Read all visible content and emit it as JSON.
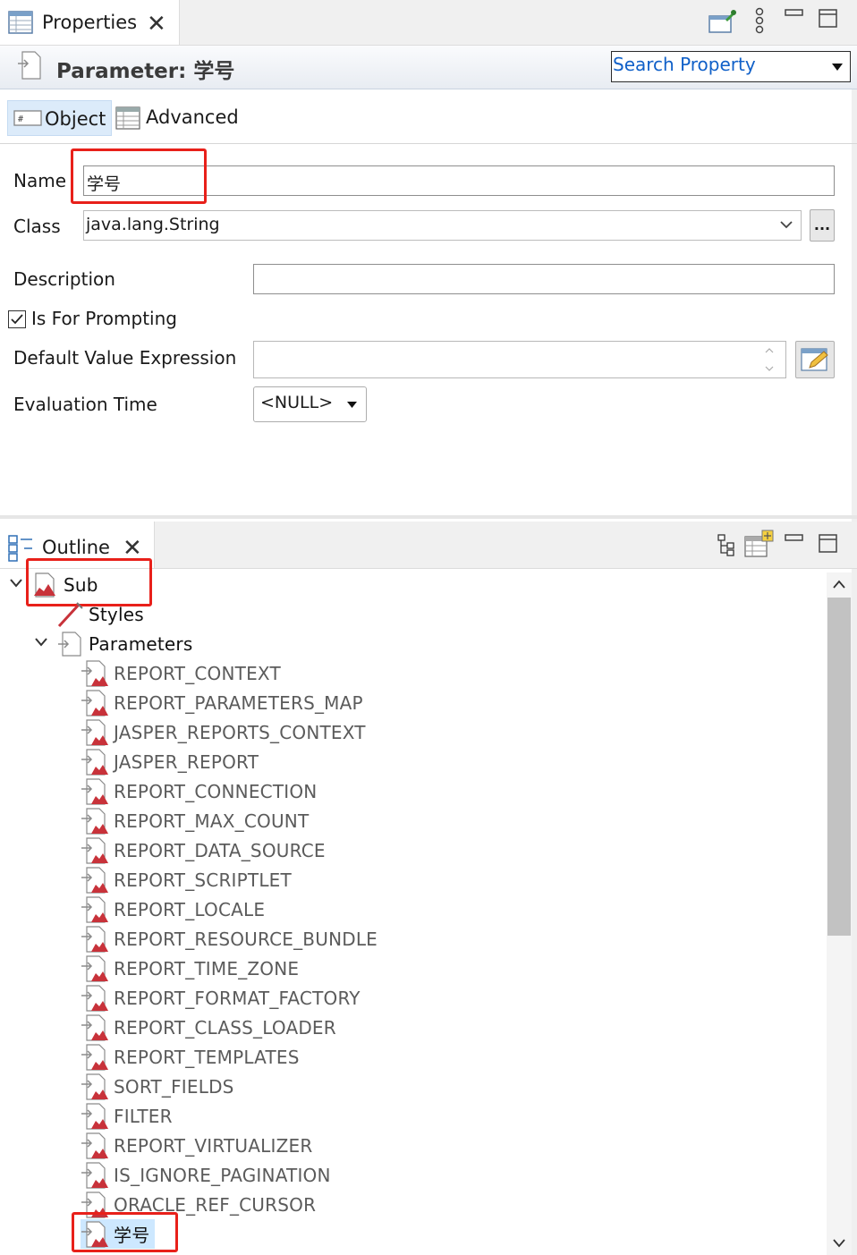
{
  "properties_view": {
    "tab_label": "Properties",
    "title": "Parameter: 学号",
    "search_label": "Search Property",
    "subtabs": {
      "object": "Object",
      "advanced": "Advanced"
    },
    "form": {
      "name_label": "Name",
      "name_value": "学号",
      "class_label": "Class",
      "class_value": "java.lang.String",
      "browse_label": "...",
      "description_label": "Description",
      "description_value": "",
      "prompting_label": "Is For Prompting",
      "prompting_checked": true,
      "default_value_label": "Default Value Expression",
      "default_value_value": "",
      "eval_time_label": "Evaluation Time",
      "eval_time_value": "<NULL>"
    }
  },
  "outline_view": {
    "tab_label": "Outline",
    "root": "Sub",
    "styles": "Styles",
    "parameters": "Parameters",
    "params": [
      "REPORT_CONTEXT",
      "REPORT_PARAMETERS_MAP",
      "JASPER_REPORTS_CONTEXT",
      "JASPER_REPORT",
      "REPORT_CONNECTION",
      "REPORT_MAX_COUNT",
      "REPORT_DATA_SOURCE",
      "REPORT_SCRIPTLET",
      "REPORT_LOCALE",
      "REPORT_RESOURCE_BUNDLE",
      "REPORT_TIME_ZONE",
      "REPORT_FORMAT_FACTORY",
      "REPORT_CLASS_LOADER",
      "REPORT_TEMPLATES",
      "SORT_FIELDS",
      "FILTER",
      "REPORT_VIRTUALIZER",
      "IS_IGNORE_PAGINATION",
      "ORACLE_REF_CURSOR",
      "学号"
    ],
    "selected_param": "学号"
  },
  "colors": {
    "highlight_red": "#e8201a",
    "search_blue": "#1060c8",
    "selection_blue": "#cde8ff"
  }
}
